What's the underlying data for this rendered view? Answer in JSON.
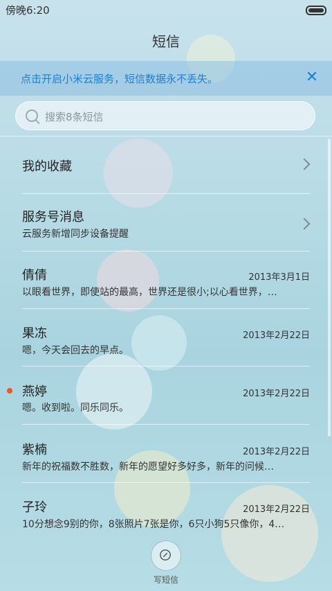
{
  "status_bar": {
    "time": "傍晚6:20"
  },
  "header": {
    "title": "短信"
  },
  "banner": {
    "text": "点击开启小米云服务，短信数据永不丢失。"
  },
  "search": {
    "placeholder": "搜索8条短信"
  },
  "favorites": {
    "label": "我的收藏"
  },
  "service": {
    "label": "服务号消息",
    "subtitle": "云服务新增同步设备提醒"
  },
  "messages": [
    {
      "name": "倩倩",
      "date": "2013年3月1日",
      "snippet": "以眼看世界，即使站的最高，世界还是很小;以心看世界，…",
      "unread": false
    },
    {
      "name": "果冻",
      "date": "2013年2月22日",
      "snippet": "嗯，今天会回去的早点。",
      "unread": false
    },
    {
      "name": "燕婷",
      "date": "2013年2月22日",
      "snippet": "嗯。收到啦。同乐同乐。",
      "unread": true
    },
    {
      "name": "紫楠",
      "date": "2013年2月22日",
      "snippet": "新年的祝福数不胜数，新年的愿望好多好多，新年的问候…",
      "unread": false
    },
    {
      "name": "子玲",
      "date": "2013年2月22日",
      "snippet": "10分想念9别的你，8张照片7张是你，6只小狗5只像你，4…",
      "unread": false
    }
  ],
  "compose": {
    "label": "写短信"
  },
  "colors": {
    "accent": "#1e7fd1",
    "unread": "#f0542a"
  }
}
